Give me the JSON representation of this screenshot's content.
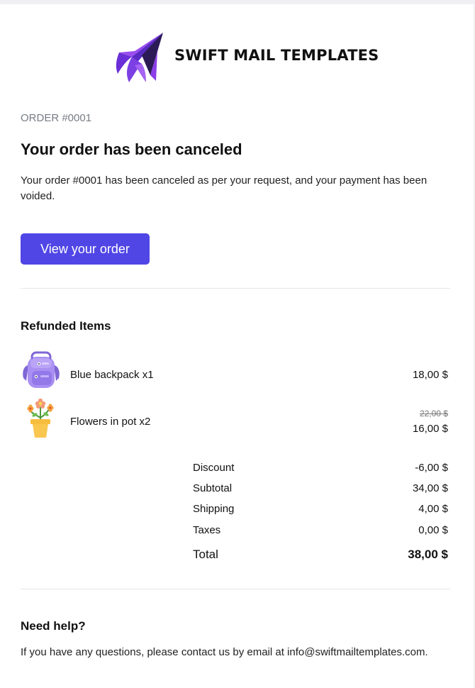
{
  "brand": {
    "name": "SWIFT MAIL TEMPLATES",
    "logo_icon": "paper-plane-logo"
  },
  "order": {
    "label": "ORDER #0001",
    "title": "Your order has been canceled",
    "message": "Your order #0001 has been canceled as per your request, and your payment has been voided.",
    "button_label": "View your order"
  },
  "refunded": {
    "title": "Refunded Items",
    "items": [
      {
        "name": "Blue backpack x1",
        "price": "18,00 $",
        "icon": "backpack-icon"
      },
      {
        "name": "Flowers in pot x2",
        "old_price": "22,00 $",
        "price": "16,00 $",
        "icon": "flower-pot-icon"
      }
    ]
  },
  "summary": {
    "rows": [
      {
        "label": "Discount",
        "value": "-6,00 $"
      },
      {
        "label": "Subtotal",
        "value": "34,00 $"
      },
      {
        "label": "Shipping",
        "value": "4,00 $"
      },
      {
        "label": "Taxes",
        "value": "0,00 $"
      }
    ],
    "total_label": "Total",
    "total_value": "38,00 $"
  },
  "help": {
    "title": "Need help?",
    "text": "If you have any questions, please contact us by email at info@swiftmailtemplates.com."
  },
  "colors": {
    "accent": "#5046e5",
    "logo_purple": "#7b3fe4",
    "backpack": "#a990f2",
    "pot": "#f7bd3f"
  }
}
